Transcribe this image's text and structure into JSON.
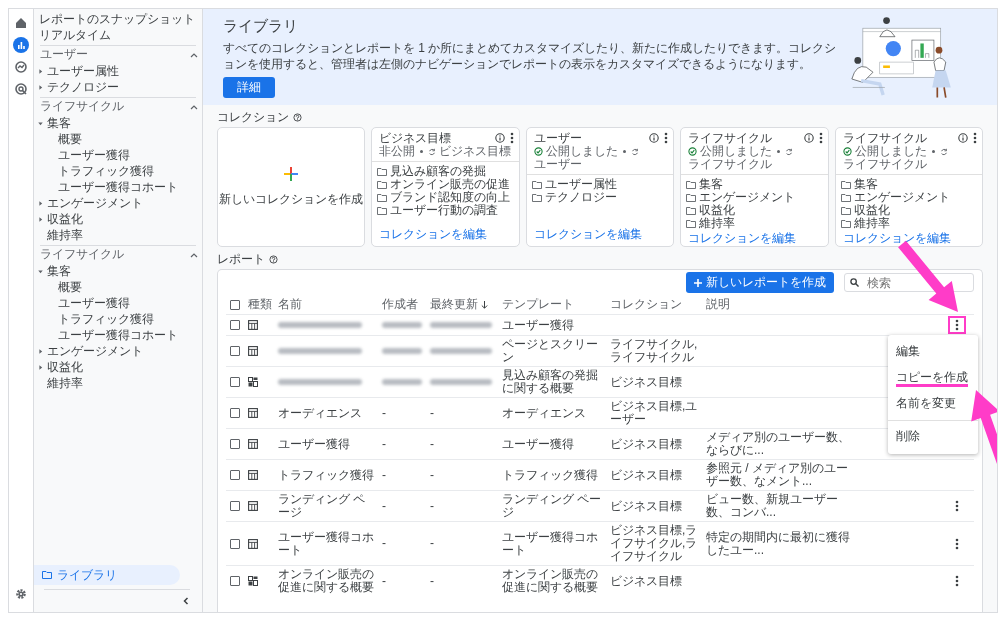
{
  "rail": {
    "items": [
      {
        "kind": "home",
        "selected": false
      },
      {
        "kind": "reports",
        "selected": true
      },
      {
        "kind": "explore",
        "selected": false
      },
      {
        "kind": "advertising",
        "selected": false
      }
    ]
  },
  "nav": {
    "top_items": [
      "レポートのスナップショット",
      "リアルタイム"
    ],
    "sections": [
      {
        "title": "ユーザー",
        "expanded": true,
        "items": [
          {
            "label": "ユーザー属性",
            "expanded": false
          },
          {
            "label": "テクノロジー",
            "expanded": false
          }
        ]
      },
      {
        "title": "ライフサイクル",
        "expanded": true,
        "items": [
          {
            "label": "集客",
            "expanded": true,
            "children": [
              {
                "label": "概要"
              },
              {
                "label": "ユーザー獲得"
              },
              {
                "label": "トラフィック獲得"
              },
              {
                "label": "ユーザー獲得コホート"
              }
            ]
          },
          {
            "label": "エンゲージメント",
            "expanded": false
          },
          {
            "label": "収益化",
            "expanded": false
          },
          {
            "label": "維持率"
          }
        ]
      },
      {
        "title": "ライフサイクル",
        "expanded": true,
        "items": [
          {
            "label": "集客",
            "expanded": true,
            "children": [
              {
                "label": "概要"
              },
              {
                "label": "ユーザー獲得"
              },
              {
                "label": "トラフィック獲得"
              },
              {
                "label": "ユーザー獲得コホート"
              }
            ]
          },
          {
            "label": "エンゲージメント",
            "expanded": false
          },
          {
            "label": "収益化",
            "expanded": false
          },
          {
            "label": "維持率"
          }
        ]
      }
    ],
    "library": {
      "label": "ライブラリ",
      "selected": true
    }
  },
  "banner": {
    "title": "ライブラリ",
    "text": "すべてのコレクションとレポートを 1 か所にまとめてカスタマイズしたり、新たに作成したりできます。コレクションを使用すると、管理者は左側のナビゲーションでレポートの表示をカスタマイズできるようになります。",
    "button": "詳細"
  },
  "collections": {
    "title": "コレクション",
    "new_card": {
      "label": "新しいコレクションを作成"
    },
    "cards": [
      {
        "title": "ビジネス目標",
        "published": false,
        "status": "非公開",
        "source": "ビジネス目標",
        "folders": [
          "見込み顧客の発掘",
          "オンライン販売の促進",
          "ブランド認知度の向上",
          "ユーザー行動の調査"
        ],
        "edit_link": "コレクションを編集"
      },
      {
        "title": "ユーザー",
        "published": true,
        "status": "公開しました",
        "source": "ユーザー",
        "folders": [
          "ユーザー属性",
          "テクノロジー"
        ],
        "edit_link": "コレクションを編集"
      },
      {
        "title": "ライフサイクル",
        "published": true,
        "status": "公開しました",
        "source": "ライフサイクル",
        "folders": [
          "集客",
          "エンゲージメント",
          "収益化",
          "維持率"
        ],
        "edit_link": "コレクションを編集"
      },
      {
        "title": "ライフサイクル",
        "published": true,
        "status": "公開しました",
        "source": "ライフサイクル",
        "folders": [
          "集客",
          "エンゲージメント",
          "収益化",
          "維持率"
        ],
        "edit_link": "コレクションを編集"
      }
    ]
  },
  "reports": {
    "title": "レポート",
    "create_button": "新しいレポートを作成",
    "search": {
      "placeholder": "検索"
    },
    "header_checked": false,
    "columns": [
      {
        "label": "種類",
        "sorted": false
      },
      {
        "label": "名前",
        "sorted": false
      },
      {
        "label": "作成者",
        "sorted": false
      },
      {
        "label": "最終更新",
        "sorted": true
      },
      {
        "label": "テンプレート",
        "sorted": false
      },
      {
        "label": "コレクション",
        "sorted": false
      },
      {
        "label": "説明",
        "sorted": false
      }
    ],
    "rows": [
      {
        "kind": "table",
        "checked": false,
        "redacted": true,
        "template": "ユーザー獲得",
        "more": true,
        "highlighted": true
      },
      {
        "kind": "table",
        "checked": false,
        "redacted": true,
        "template": "ページとスクリーン",
        "collection": "ライフサイクル,ライフサイクル",
        "more": false
      },
      {
        "kind": "summary",
        "checked": false,
        "redacted": true,
        "template": "見込み顧客の発掘に関する概要",
        "collection": "ビジネス目標",
        "more": false
      },
      {
        "kind": "table",
        "checked": false,
        "redacted": false,
        "name": "オーディエンス",
        "author": "-",
        "updated": "-",
        "template": "オーディエンス",
        "collection": "ビジネス目標,ユーザー",
        "more": false
      },
      {
        "kind": "table",
        "checked": false,
        "redacted": false,
        "name": "ユーザー獲得",
        "author": "-",
        "updated": "-",
        "template": "ユーザー獲得",
        "collection": "ビジネス目標",
        "description": "メディア別のユーザー数、ならびに...",
        "more": false
      },
      {
        "kind": "table",
        "checked": false,
        "redacted": false,
        "name": "トラフィック獲得",
        "author": "-",
        "updated": "-",
        "template": "トラフィック獲得",
        "collection": "ビジネス目標",
        "description": "参照元 / メディア別のユーザー数、なメント...",
        "more": false
      },
      {
        "kind": "table",
        "checked": false,
        "redacted": false,
        "name": "ランディング ページ",
        "author": "-",
        "updated": "-",
        "template": "ランディング ページ",
        "collection": "ビジネス目標",
        "description": "ビュー数、新規ユーザー数、コンバ...",
        "more": true,
        "highlighted": false
      },
      {
        "kind": "table",
        "checked": false,
        "redacted": false,
        "name": "ユーザー獲得コホート",
        "author": "-",
        "updated": "-",
        "template": "ユーザー獲得コホート",
        "collection": "ビジネス目標,ライフサイクル,ライフサイクル",
        "description": "特定の期間内に最初に獲得したユー...",
        "more": true,
        "highlighted": false
      },
      {
        "kind": "summary",
        "checked": false,
        "redacted": false,
        "name": "オンライン販売の促進に関する概要",
        "author": "-",
        "updated": "-",
        "template": "オンライン販売の促進に関する概要",
        "collection": "ビジネス目標",
        "more": true,
        "highlighted": false
      }
    ],
    "menu": {
      "items": [
        {
          "label": "編集",
          "highlighted": false,
          "divider_before": false
        },
        {
          "label": "コピーを作成",
          "highlighted": true,
          "divider_before": false
        },
        {
          "label": "名前を変更",
          "highlighted": false,
          "divider_before": false
        },
        {
          "label": "削除",
          "highlighted": false,
          "divider_before": true
        }
      ]
    }
  }
}
